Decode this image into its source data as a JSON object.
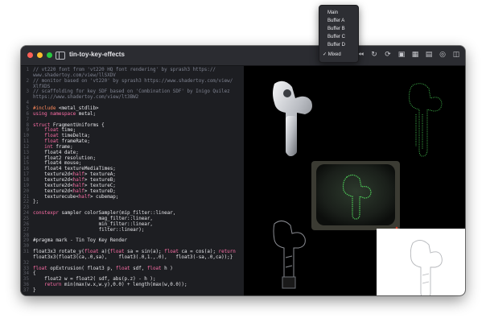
{
  "window": {
    "title": "tin-toy-key-effects"
  },
  "toolbar": {
    "icons": [
      "pause-icon",
      "skip-back-icon",
      "reload-icon",
      "refresh-icon",
      "camera-icon",
      "grid-icon",
      "film-icon",
      "record-icon",
      "sidebar-right-icon"
    ]
  },
  "menu": {
    "items": [
      "Main",
      "Buffer A",
      "Buffer B",
      "Buffer C",
      "Buffer D",
      "✓ Mixed"
    ],
    "selected": "Mixed"
  },
  "code": {
    "lines": [
      {
        "n": "1",
        "parts": [
          [
            "c-comment",
            "// vt220 font from 'vt220 HQ font rendering' by sprash3 https://"
          ]
        ]
      },
      {
        "n": "",
        "parts": [
          [
            "c-comment",
            "www.shadertoy.com/view/llSXDV"
          ]
        ]
      },
      {
        "n": "2",
        "parts": [
          [
            "c-comment",
            "// monitor based on 'vt220' by sprash3 https://www.shadertoy.com/view/"
          ]
        ]
      },
      {
        "n": "",
        "parts": [
          [
            "c-comment",
            "XlfXDS"
          ]
        ]
      },
      {
        "n": "3",
        "parts": [
          [
            "c-comment",
            "// scaffolding for key SDF based on 'Combination SDF' by Inigo Quilez"
          ]
        ]
      },
      {
        "n": "",
        "parts": [
          [
            "c-comment",
            "https://www.shadertoy.com/view/lt3BW2"
          ]
        ]
      },
      {
        "n": "4",
        "parts": []
      },
      {
        "n": "5",
        "parts": [
          [
            "c-pre",
            "#include "
          ],
          [
            "c-plain",
            "<metal_stdlib>"
          ]
        ]
      },
      {
        "n": "6",
        "parts": [
          [
            "c-kw",
            "using namespace "
          ],
          [
            "c-plain",
            "metal;"
          ]
        ]
      },
      {
        "n": "7",
        "parts": []
      },
      {
        "n": "8",
        "parts": [
          [
            "c-kw",
            "struct "
          ],
          [
            "c-plain",
            "FragmentUniforms {"
          ]
        ]
      },
      {
        "n": "9",
        "parts": [
          [
            "c-kw",
            "    float "
          ],
          [
            "c-plain",
            "time;"
          ]
        ]
      },
      {
        "n": "10",
        "parts": [
          [
            "c-kw",
            "    float "
          ],
          [
            "c-plain",
            "timeDelta;"
          ]
        ]
      },
      {
        "n": "11",
        "parts": [
          [
            "c-kw",
            "    float "
          ],
          [
            "c-plain",
            "frameRate;"
          ]
        ]
      },
      {
        "n": "12",
        "parts": [
          [
            "c-kw",
            "    int "
          ],
          [
            "c-plain",
            "frame;"
          ]
        ]
      },
      {
        "n": "13",
        "parts": [
          [
            "c-plain",
            "    float4 date;"
          ]
        ]
      },
      {
        "n": "14",
        "parts": [
          [
            "c-plain",
            "    float2 resolution;"
          ]
        ]
      },
      {
        "n": "15",
        "parts": [
          [
            "c-plain",
            "    float4 mouse;"
          ]
        ]
      },
      {
        "n": "16",
        "parts": [
          [
            "c-plain",
            "    float4 textureMediaTimes;"
          ]
        ]
      },
      {
        "n": "17",
        "parts": [
          [
            "c-plain",
            "    texture2d<"
          ],
          [
            "c-kw",
            "half"
          ],
          [
            "c-plain",
            "> textureA;"
          ]
        ]
      },
      {
        "n": "18",
        "parts": [
          [
            "c-plain",
            "    texture2d<"
          ],
          [
            "c-kw",
            "half"
          ],
          [
            "c-plain",
            "> textureB;"
          ]
        ]
      },
      {
        "n": "19",
        "parts": [
          [
            "c-plain",
            "    texture2d<"
          ],
          [
            "c-kw",
            "half"
          ],
          [
            "c-plain",
            "> textureC;"
          ]
        ]
      },
      {
        "n": "20",
        "parts": [
          [
            "c-plain",
            "    texture2d<"
          ],
          [
            "c-kw",
            "half"
          ],
          [
            "c-plain",
            "> textureD;"
          ]
        ]
      },
      {
        "n": "21",
        "parts": [
          [
            "c-plain",
            "    texturecube<"
          ],
          [
            "c-kw",
            "half"
          ],
          [
            "c-plain",
            "> cubemap;"
          ]
        ]
      },
      {
        "n": "22",
        "parts": [
          [
            "c-plain",
            "};"
          ]
        ]
      },
      {
        "n": "23",
        "parts": []
      },
      {
        "n": "24",
        "parts": [
          [
            "c-kw",
            "constexpr "
          ],
          [
            "c-plain",
            "sampler colorSampler(mip_filter::linear,"
          ]
        ]
      },
      {
        "n": "25",
        "parts": [
          [
            "c-plain",
            "                       mag_filter::linear,"
          ]
        ]
      },
      {
        "n": "26",
        "parts": [
          [
            "c-plain",
            "                       min_filter::linear,"
          ]
        ]
      },
      {
        "n": "27",
        "parts": [
          [
            "c-plain",
            "                       filter::linear);"
          ]
        ]
      },
      {
        "n": "28",
        "parts": []
      },
      {
        "n": "29",
        "parts": [
          [
            "c-plain",
            "#pragma mark - Tin Toy Key Render"
          ]
        ]
      },
      {
        "n": "30",
        "parts": []
      },
      {
        "n": "31",
        "parts": [
          [
            "c-plain",
            "float3x3 rotate_y("
          ],
          [
            "c-kw",
            "float "
          ],
          [
            "c-plain",
            "a){"
          ],
          [
            "c-kw",
            "float "
          ],
          [
            "c-plain",
            "sa = sin(a); "
          ],
          [
            "c-kw",
            "float "
          ],
          [
            "c-plain",
            "ca = cos(a); "
          ],
          [
            "c-kw",
            "return"
          ]
        ]
      },
      {
        "n": "",
        "parts": [
          [
            "c-plain",
            "float3x3(float3(ca,.0,sa),    float3(.0,1.,.0),   float3(-sa,.0,ca));}"
          ]
        ]
      },
      {
        "n": "32",
        "parts": []
      },
      {
        "n": "33",
        "parts": [
          [
            "c-kw",
            "float "
          ],
          [
            "c-plain",
            "opExtrusion( float3 p, "
          ],
          [
            "c-kw",
            "float "
          ],
          [
            "c-plain",
            "sdf, "
          ],
          [
            "c-kw",
            "float "
          ],
          [
            "c-plain",
            "h )"
          ]
        ]
      },
      {
        "n": "34",
        "parts": [
          [
            "c-plain",
            "{"
          ]
        ]
      },
      {
        "n": "35",
        "parts": [
          [
            "c-plain",
            "    float2 w = float2( sdf, abs(p.z) - h );"
          ]
        ]
      },
      {
        "n": "36",
        "parts": [
          [
            "c-kw",
            "    return "
          ],
          [
            "c-plain",
            "min(max(w.x,w.y),0.0) + length(max(w,0.0));"
          ]
        ]
      },
      {
        "n": "37",
        "parts": [
          [
            "c-plain",
            "}"
          ]
        ]
      }
    ]
  }
}
